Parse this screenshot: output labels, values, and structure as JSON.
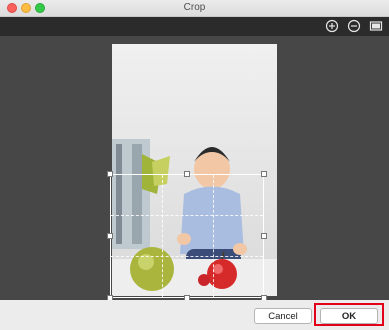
{
  "window": {
    "title": "Crop"
  },
  "toolbar": {
    "zoom_in": "zoom-in-icon",
    "zoom_out": "zoom-out-icon",
    "fit": "fit-to-window-icon"
  },
  "footer": {
    "cancel_label": "Cancel",
    "ok_label": "OK"
  },
  "colors": {
    "toolbar_bg": "#2b2b2b",
    "canvas_bg": "#474747",
    "highlight": "#e2001a"
  }
}
